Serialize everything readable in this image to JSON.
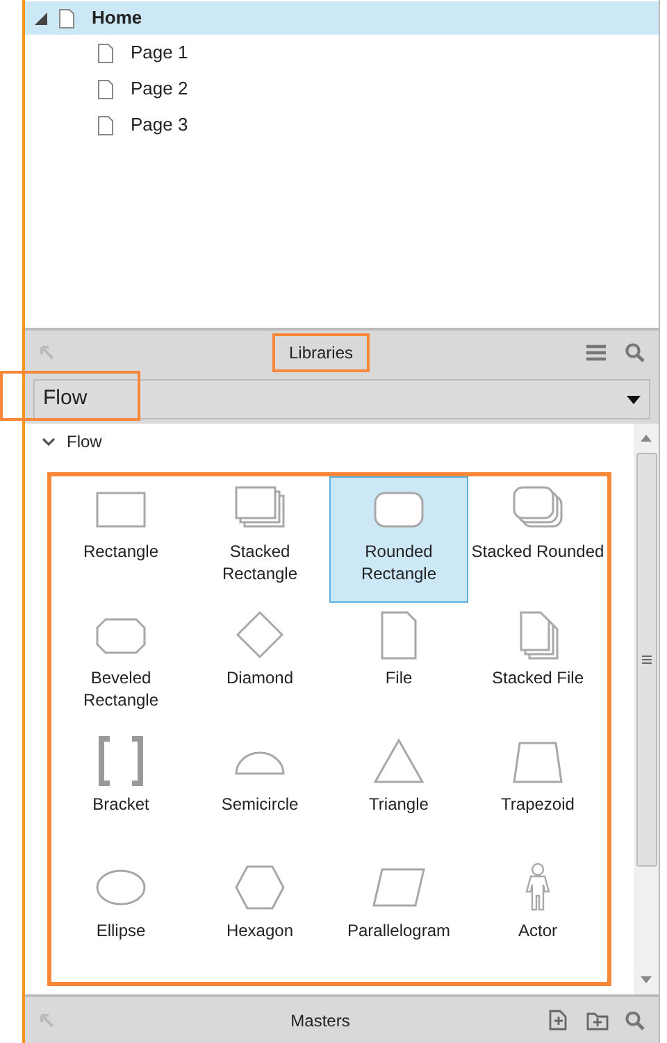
{
  "pages": {
    "root": {
      "label": "Home",
      "selected": true,
      "expanded": true
    },
    "children": [
      {
        "label": "Page 1",
        "selected": false
      },
      {
        "label": "Page 2",
        "selected": false
      },
      {
        "label": "Page 3",
        "selected": false
      }
    ]
  },
  "libraries": {
    "title": "Libraries",
    "title_highlighted": true,
    "dropdown": {
      "value": "Flow",
      "highlighted": true
    },
    "section": {
      "label": "Flow",
      "expanded": true
    },
    "grid_highlighted": true,
    "shapes": [
      {
        "kind": "rectangle",
        "label": "Rectangle",
        "selected": false
      },
      {
        "kind": "stacked-rectangle",
        "label": "Stacked Rectangle",
        "selected": false
      },
      {
        "kind": "rounded-rectangle",
        "label": "Rounded Rectangle",
        "selected": true
      },
      {
        "kind": "stacked-rounded",
        "label": "Stacked Rounded",
        "selected": false
      },
      {
        "kind": "beveled-rectangle",
        "label": "Beveled Rectangle",
        "selected": false
      },
      {
        "kind": "diamond",
        "label": "Diamond",
        "selected": false
      },
      {
        "kind": "file",
        "label": "File",
        "selected": false
      },
      {
        "kind": "stacked-file",
        "label": "Stacked File",
        "selected": false
      },
      {
        "kind": "bracket",
        "label": "Bracket",
        "selected": false
      },
      {
        "kind": "semicircle",
        "label": "Semicircle",
        "selected": false
      },
      {
        "kind": "triangle",
        "label": "Triangle",
        "selected": false
      },
      {
        "kind": "trapezoid",
        "label": "Trapezoid",
        "selected": false
      },
      {
        "kind": "ellipse",
        "label": "Ellipse",
        "selected": false
      },
      {
        "kind": "hexagon",
        "label": "Hexagon",
        "selected": false
      },
      {
        "kind": "parallelogram",
        "label": "Parallelogram",
        "selected": false
      },
      {
        "kind": "actor",
        "label": "Actor",
        "selected": false
      }
    ]
  },
  "masters": {
    "title": "Masters"
  }
}
